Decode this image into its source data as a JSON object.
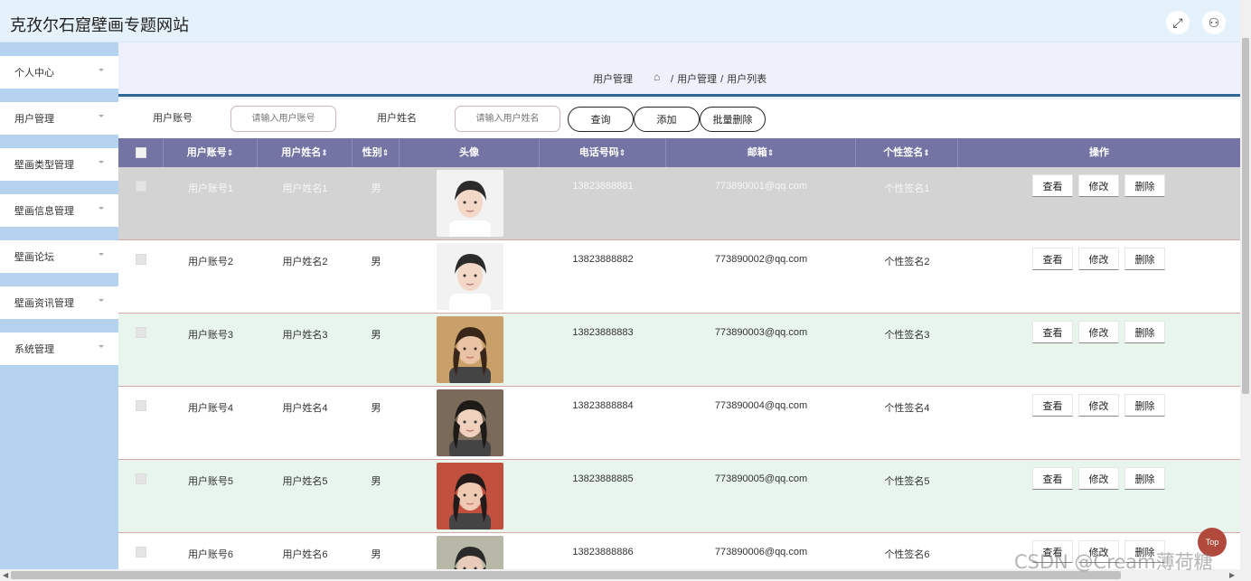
{
  "header": {
    "site_title": "克孜尔石窟壁画专题网站",
    "fullscreen_icon": "⤢",
    "user_icon": "⚇"
  },
  "sidebar": {
    "items": [
      {
        "label": "个人中心"
      },
      {
        "label": "用户管理"
      },
      {
        "label": "壁画类型管理"
      },
      {
        "label": "壁画信息管理"
      },
      {
        "label": "壁画论坛"
      },
      {
        "label": "壁画资讯管理"
      },
      {
        "label": "系统管理"
      }
    ]
  },
  "breadcrumb": {
    "title": "用户管理",
    "home_icon": "⌂",
    "path": [
      "用户管理",
      "用户列表"
    ],
    "separator": "/"
  },
  "search": {
    "account_label": "用户账号",
    "account_placeholder": "请输入用户账号",
    "name_label": "用户姓名",
    "name_placeholder": "请输入用户姓名",
    "query_btn": "查询",
    "add_btn": "添加",
    "batch_delete_btn": "批量删除"
  },
  "table": {
    "columns": [
      "用户账号",
      "用户姓名",
      "性别",
      "头像",
      "电话号码",
      "邮箱",
      "个性签名",
      "操作"
    ],
    "sortable_columns": [
      true,
      true,
      true,
      false,
      true,
      true,
      true,
      false
    ],
    "sort_mark": "⇕",
    "actions": [
      "查看",
      "修改",
      "删除"
    ],
    "rows": [
      {
        "account": "用户账号1",
        "name": "用户姓名1",
        "gender": "男",
        "phone": "13823888881",
        "email": "773890001@qq.com",
        "signature": "个性签名1"
      },
      {
        "account": "用户账号2",
        "name": "用户姓名2",
        "gender": "男",
        "phone": "13823888882",
        "email": "773890002@qq.com",
        "signature": "个性签名2"
      },
      {
        "account": "用户账号3",
        "name": "用户姓名3",
        "gender": "男",
        "phone": "13823888883",
        "email": "773890003@qq.com",
        "signature": "个性签名3"
      },
      {
        "account": "用户账号4",
        "name": "用户姓名4",
        "gender": "男",
        "phone": "13823888884",
        "email": "773890004@qq.com",
        "signature": "个性签名4"
      },
      {
        "account": "用户账号5",
        "name": "用户姓名5",
        "gender": "男",
        "phone": "13823888885",
        "email": "773890005@qq.com",
        "signature": "个性签名5"
      },
      {
        "account": "用户账号6",
        "name": "用户姓名6",
        "gender": "男",
        "phone": "13823888886",
        "email": "773890006@qq.com",
        "signature": "个性签名6"
      }
    ]
  },
  "colors": {
    "header_bg": "#e6f2fb",
    "sidebar_bg": "#b5d2ef",
    "table_header_bg": "#7374a3",
    "crumb_underline": "#2e6796",
    "row_selected": "#d3d3d3",
    "row_alt": "#e8f5ec",
    "top_button": "#b1493d"
  },
  "back_to_top": "Top",
  "watermark": "CSDN @Cream薄荷糖"
}
